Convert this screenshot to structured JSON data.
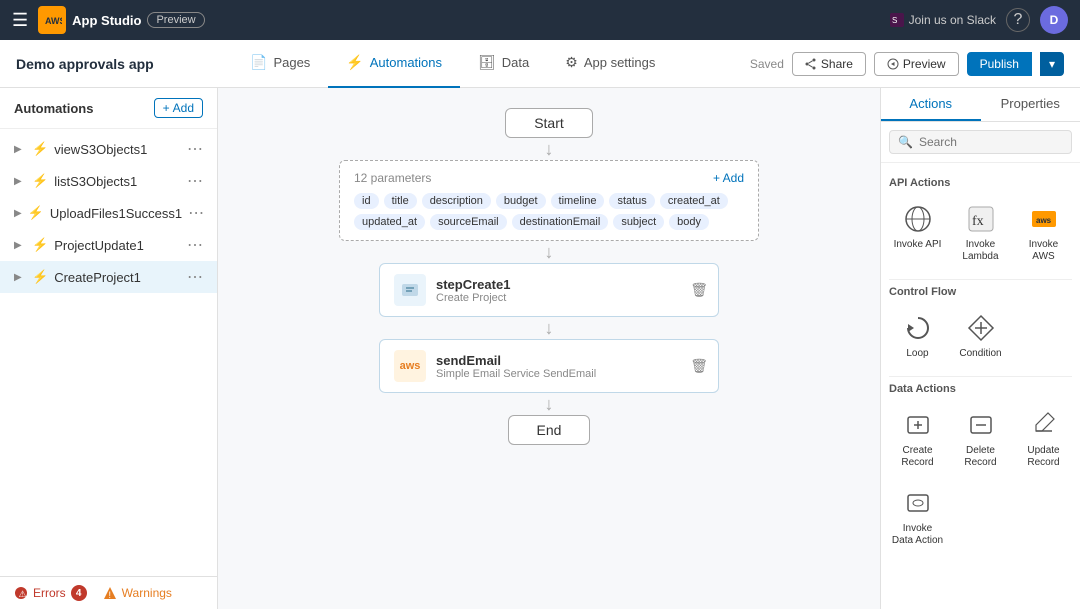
{
  "app": {
    "title": "Demo approvals app"
  },
  "topnav": {
    "logo_text": "App Studio",
    "preview_badge": "Preview",
    "slack_label": "Join us on Slack",
    "help_label": "?",
    "avatar_label": "D"
  },
  "header": {
    "saved_text": "Saved",
    "share_label": "Share",
    "preview_label": "Preview",
    "publish_label": "Publish",
    "tabs": [
      {
        "id": "pages",
        "label": "Pages",
        "icon": "📄",
        "active": false
      },
      {
        "id": "automations",
        "label": "Automations",
        "icon": "⚡",
        "active": true
      },
      {
        "id": "data",
        "label": "Data",
        "icon": "🗄",
        "active": false
      },
      {
        "id": "app-settings",
        "label": "App settings",
        "icon": "⚙",
        "active": false
      }
    ]
  },
  "sidebar": {
    "title": "Automations",
    "add_label": "Add",
    "items": [
      {
        "id": "viewS3Objects1",
        "label": "viewS3Objects1",
        "active": false
      },
      {
        "id": "listS3Objects1",
        "label": "listS3Objects1",
        "active": false
      },
      {
        "id": "UploadFiles1Success1",
        "label": "UploadFiles1Success1",
        "active": false
      },
      {
        "id": "ProjectUpdate1",
        "label": "ProjectUpdate1",
        "active": false
      },
      {
        "id": "CreateProject1",
        "label": "CreateProject1",
        "active": true
      }
    ],
    "footer": {
      "errors_label": "Errors",
      "errors_count": "4",
      "warnings_label": "Warnings"
    }
  },
  "canvas": {
    "start_label": "Start",
    "end_label": "End",
    "params_count": "12 parameters",
    "add_label": "+ Add",
    "params": [
      "id",
      "title",
      "description",
      "budget",
      "timeline",
      "status",
      "created_at",
      "updated_at",
      "sourceEmail",
      "destinationEmail",
      "subject",
      "body"
    ],
    "steps": [
      {
        "id": "stepCreate1",
        "name": "stepCreate1",
        "sub": "Create Project",
        "icon_type": "db",
        "icon_label": "📋"
      },
      {
        "id": "sendEmail",
        "name": "sendEmail",
        "sub": "Simple Email Service SendEmail",
        "icon_type": "aws",
        "icon_label": "aws"
      }
    ]
  },
  "right_panel": {
    "tabs": [
      {
        "id": "actions",
        "label": "Actions",
        "active": true
      },
      {
        "id": "properties",
        "label": "Properties",
        "active": false
      }
    ],
    "search_placeholder": "Search",
    "sections": [
      {
        "title": "API Actions",
        "items": [
          {
            "id": "invoke-api",
            "label": "Invoke API",
            "icon": "globe"
          },
          {
            "id": "invoke-lambda",
            "label": "Invoke Lambda",
            "icon": "fx"
          },
          {
            "id": "invoke-aws",
            "label": "Invoke AWS",
            "icon": "aws"
          }
        ]
      },
      {
        "title": "Control Flow",
        "items": [
          {
            "id": "loop",
            "label": "Loop",
            "icon": "loop"
          },
          {
            "id": "condition",
            "label": "Condition",
            "icon": "condition"
          }
        ]
      },
      {
        "title": "Data Actions",
        "items": [
          {
            "id": "create-record",
            "label": "Create Record",
            "icon": "create-record"
          },
          {
            "id": "delete-record",
            "label": "Delete Record",
            "icon": "delete-record"
          },
          {
            "id": "update-record",
            "label": "Update Record",
            "icon": "update-record"
          },
          {
            "id": "invoke-data-action",
            "label": "Invoke Data Action",
            "icon": "data-action"
          }
        ]
      }
    ]
  }
}
